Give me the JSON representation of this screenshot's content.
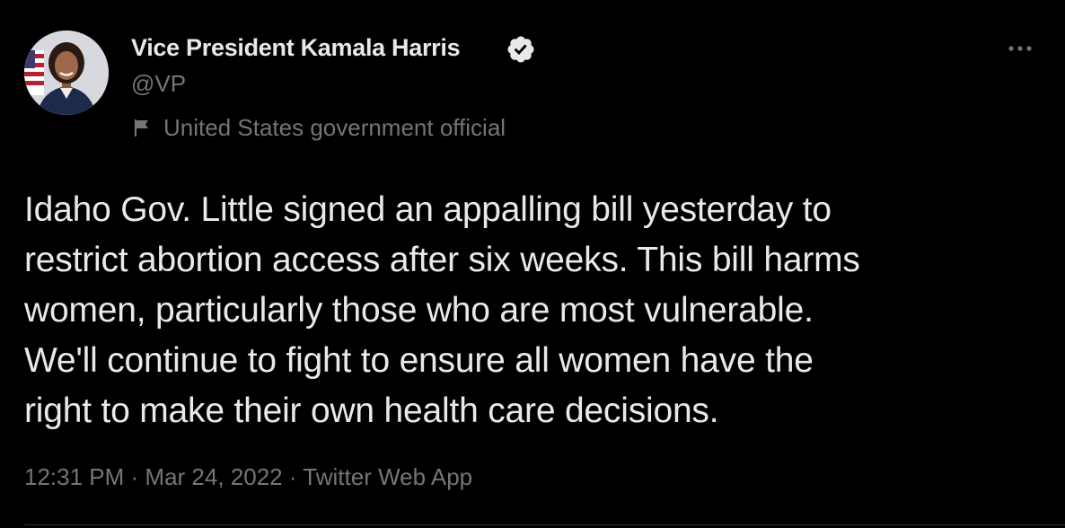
{
  "author": {
    "display_name": "Vice President Kamala Harris",
    "handle": "@VP",
    "verified_icon": "verified-badge-icon",
    "label": "United States government official",
    "label_icon": "flag-icon"
  },
  "menu": {
    "more_icon": "more-options-icon"
  },
  "tweet": {
    "lines": [
      "Idaho Gov. Little signed an appalling bill yesterday to",
      "restrict abortion access after six weeks. This bill harms",
      "women, particularly those who are most vulnerable.",
      "We'll continue to fight to ensure all women have the",
      "right to make their own health care decisions."
    ]
  },
  "meta": {
    "time": "12:31 PM",
    "separator": "·",
    "date": "Mar 24, 2022",
    "source": "Twitter Web App"
  },
  "colors": {
    "background": "#000000",
    "text_primary": "#e7e9ea",
    "text_secondary": "#71767b",
    "divider": "#2f3336"
  }
}
